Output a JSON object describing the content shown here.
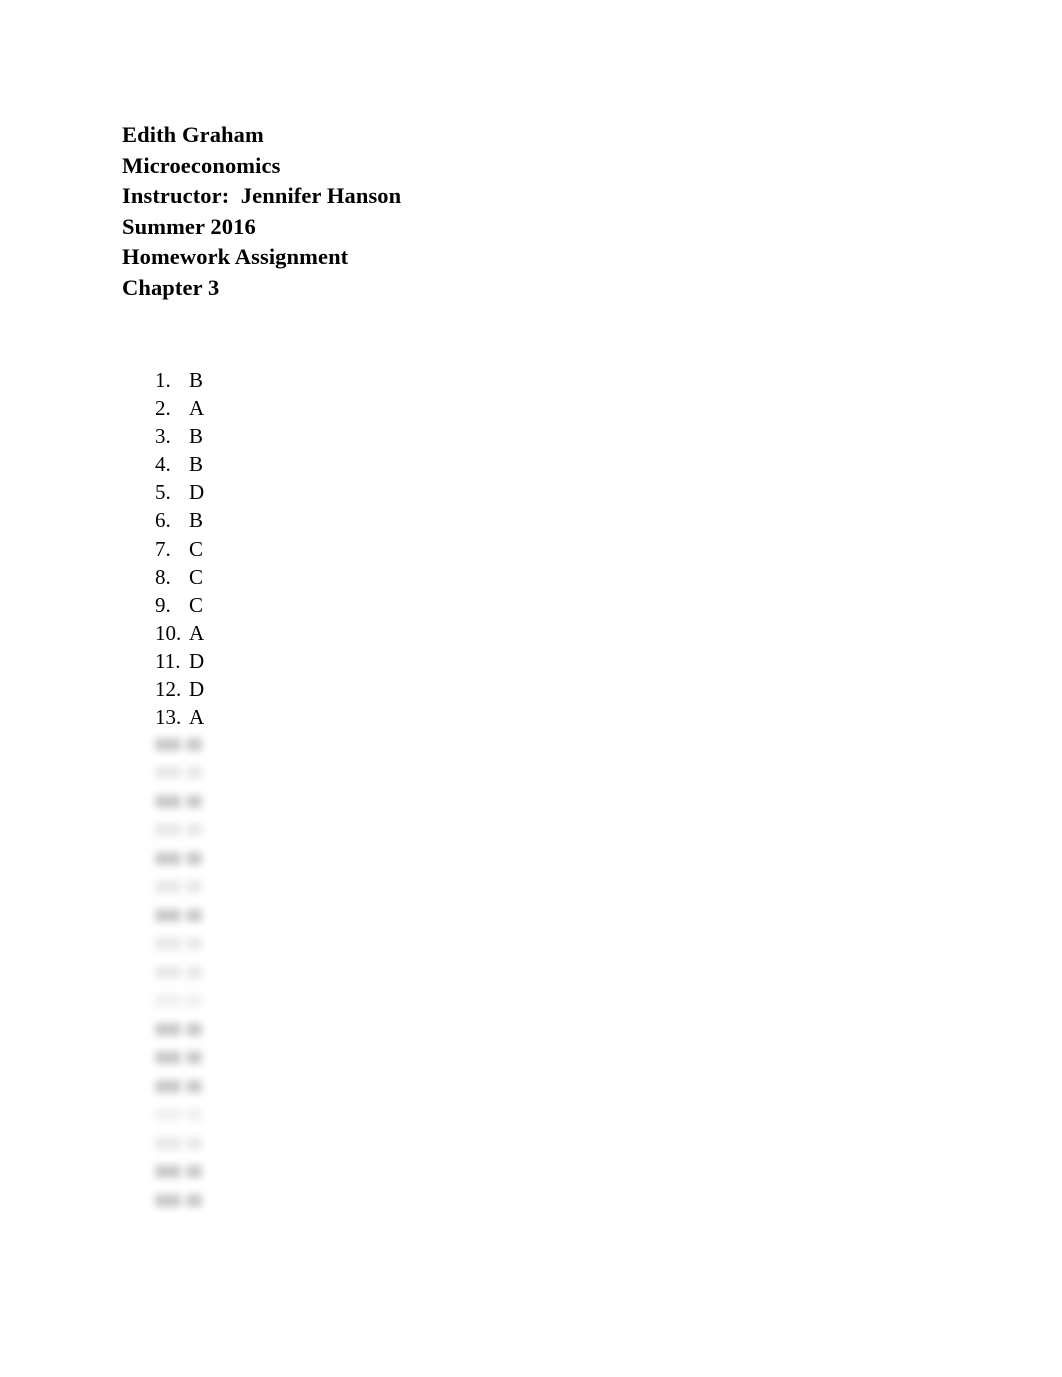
{
  "document": {
    "page_background": "#ffffff",
    "text_color": "#000000",
    "header_lines": [
      "Edith Graham",
      "Microeconomics",
      "Instructor:  Jennifer Hanson",
      "Summer 2016",
      "Homework Assignment",
      "Chapter 3"
    ],
    "answers": [
      {
        "number": "1.",
        "answer": "B"
      },
      {
        "number": "2.",
        "answer": "A"
      },
      {
        "number": "3.",
        "answer": "B"
      },
      {
        "number": "4.",
        "answer": "B"
      },
      {
        "number": "5.",
        "answer": "D"
      },
      {
        "number": "6.",
        "answer": "B"
      },
      {
        "number": "7.",
        "answer": "C"
      },
      {
        "number": "8.",
        "answer": "C"
      },
      {
        "number": "9.",
        "answer": "C"
      },
      {
        "number": "10.",
        "answer": "A"
      },
      {
        "number": "11.",
        "answer": "D"
      },
      {
        "number": "12.",
        "answer": "D"
      },
      {
        "number": "13.",
        "answer": "A"
      }
    ],
    "redacted": {
      "description": "blurred illegible continuation of the answer list",
      "line_count": 17,
      "blur_color": "#9a9a9a",
      "intensities": [
        "strong",
        "faint",
        "strong",
        "faint",
        "strong",
        "faint",
        "strong",
        "faint",
        "faint",
        "veryfaint",
        "strong",
        "strong",
        "strong",
        "veryfaint",
        "faint",
        "strong",
        "strong"
      ]
    }
  }
}
